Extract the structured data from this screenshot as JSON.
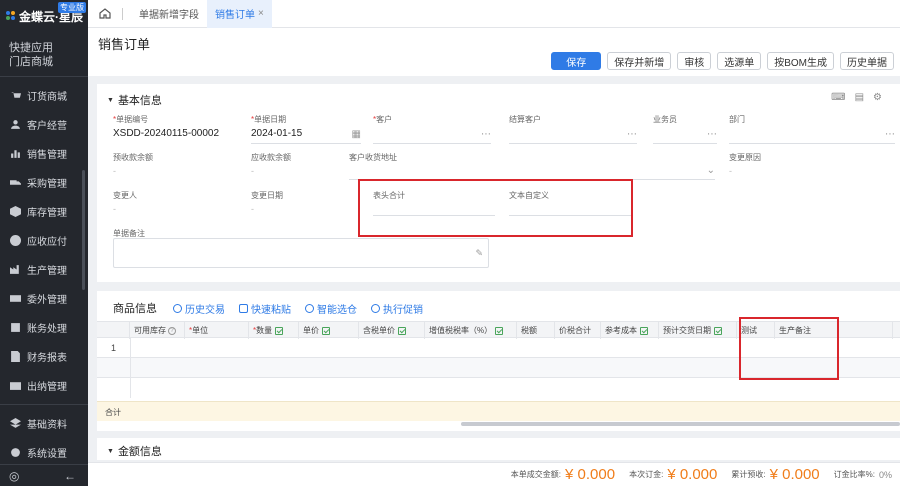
{
  "brand": {
    "name": "金蝶云·星辰",
    "edition": "专业版"
  },
  "sidebar": {
    "quick": [
      "快捷应用",
      "门店商城"
    ],
    "items": [
      {
        "label": "订货商城",
        "icon": "cart-icon"
      },
      {
        "label": "客户经营",
        "icon": "user-icon"
      },
      {
        "label": "销售管理",
        "icon": "sales-icon"
      },
      {
        "label": "采购管理",
        "icon": "truck-icon"
      },
      {
        "label": "库存管理",
        "icon": "box-icon"
      },
      {
        "label": "应收应付",
        "icon": "money-icon"
      },
      {
        "label": "生产管理",
        "icon": "factory-icon"
      },
      {
        "label": "委外管理",
        "icon": "outsource-icon"
      },
      {
        "label": "账务处理",
        "icon": "ledger-icon"
      },
      {
        "label": "财务报表",
        "icon": "report-icon"
      },
      {
        "label": "出纳管理",
        "icon": "cashier-icon"
      },
      {
        "label": "基础资料",
        "icon": "layers-icon"
      },
      {
        "label": "系统设置",
        "icon": "settings-icon"
      }
    ]
  },
  "tabs": [
    {
      "label": "单据新增字段"
    },
    {
      "label": "销售订单",
      "close": "×"
    }
  ],
  "page": {
    "title": "销售订单"
  },
  "toolbar": [
    "保存",
    "保存并新增",
    "审核",
    "选源单",
    "按BOM生成",
    "历史单据"
  ],
  "basic": {
    "title": "基本信息",
    "fields": {
      "bill_no": {
        "label": "单据编号",
        "value": "XSDD-20240115-00002"
      },
      "bill_date": {
        "label": "单据日期",
        "value": "2024-01-15"
      },
      "customer": {
        "label": "客户",
        "value": ""
      },
      "settle_customer": {
        "label": "结算客户",
        "value": ""
      },
      "salesman": {
        "label": "业务员",
        "value": ""
      },
      "dept": {
        "label": "部门",
        "value": ""
      },
      "advance_balance": {
        "label": "预收款余额",
        "value": "-"
      },
      "receivable_balance": {
        "label": "应收款余额",
        "value": "-"
      },
      "ship_address": {
        "label": "客户收货地址",
        "value": ""
      },
      "change_reason": {
        "label": "变更原因",
        "value": "-"
      },
      "changer": {
        "label": "变更人",
        "value": "-"
      },
      "change_date": {
        "label": "变更日期",
        "value": "-"
      },
      "header_total": {
        "label": "表头合计",
        "value": ""
      },
      "text_custom": {
        "label": "文本自定义",
        "value": ""
      },
      "memo": {
        "label": "单据备注",
        "value": ""
      }
    }
  },
  "goods": {
    "title": "商品信息",
    "actions": [
      "历史交易",
      "快速粘贴",
      "智能选仓",
      "执行促销"
    ],
    "columns": [
      "可用库存",
      "单位",
      "数量",
      "单价",
      "含税单价",
      "增值税税率（%）",
      "税额",
      "价税合计",
      "参考成本",
      "预计交货日期",
      "测试",
      "生产备注"
    ],
    "rows": [
      {
        "num": "1"
      }
    ],
    "total_label": "合计"
  },
  "amount": {
    "title": "金额信息"
  },
  "footer": {
    "deal_label": "本单成交金额:",
    "deal_value": "¥ 0.000",
    "deposit_label": "本次订金:",
    "deposit_value": "¥ 0.000",
    "total_advance_label": "累计预收:",
    "total_advance_value": "¥ 0.000",
    "ratio_label": "订金比率%:",
    "ratio_value": "0%"
  },
  "colors": {
    "accent": "#2f7be6",
    "sidebar": "#24272d",
    "highlight": "#d9262c",
    "amount": "#f07d1a"
  }
}
